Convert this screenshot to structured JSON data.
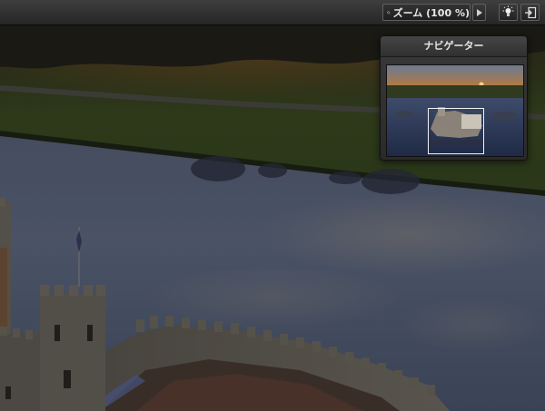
{
  "toolbar": {
    "zoom_label": "ズーム (100 %)",
    "icons": {
      "zoom": "magnifier-icon",
      "play": "play-triangle-icon",
      "light": "lightbulb-icon",
      "exit": "exit-fullscreen-icon"
    }
  },
  "navigator": {
    "title": "ナビゲーター"
  },
  "colors": {
    "toolbar": "#2e2e2e",
    "panel": "#333333",
    "water": "#5a6478",
    "grass": "#3a4a22",
    "stone": "#6b665e"
  }
}
